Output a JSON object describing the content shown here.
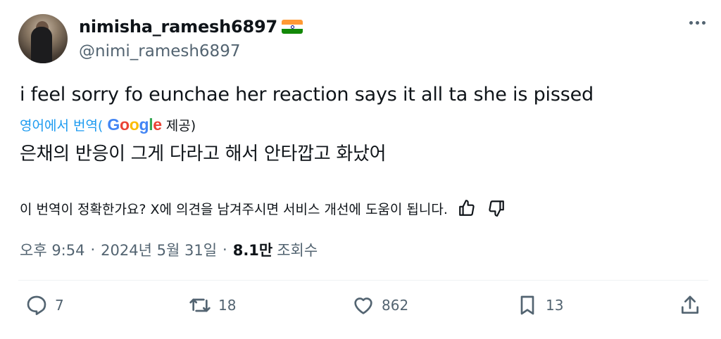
{
  "author": {
    "display_name": "nimisha_ramesh6897",
    "flag_icon": "india-flag-emoji",
    "handle": "@nimi_ramesh6897"
  },
  "tweet": {
    "text": "i feel sorry fo eunchae her reaction says it all ta she is pissed"
  },
  "translation": {
    "link_label": "영어에서 번역(",
    "provider_brand": "Google",
    "provider_suffix": " 제공)",
    "text": "은채의 반응이 그게 다라고 해서 안타깝고 화났어",
    "feedback_prompt": "이 번역이 정확한가요? X에 의견을 남겨주시면 서비스 개선에 도움이 됩니다."
  },
  "meta": {
    "time": "오후 9:54",
    "separator": "·",
    "date": "2024년 5월 31일",
    "views_count": "8.1만",
    "views_label": "조회수"
  },
  "actions": {
    "replies": "7",
    "reposts": "18",
    "likes": "862",
    "bookmarks": "13"
  },
  "colors": {
    "text_primary": "#0f1419",
    "text_secondary": "#536471",
    "link": "#1d9bf0",
    "divider": "#eff3f4"
  }
}
